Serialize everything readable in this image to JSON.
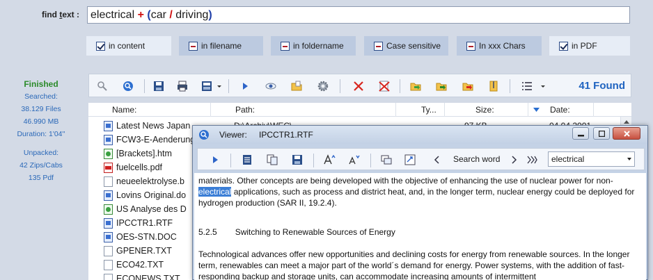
{
  "find": {
    "label_pre": "find ",
    "label_u": "t",
    "label_post": "ext :",
    "q1": "electrical ",
    "plus": "+",
    "open": " (",
    "q2": "car ",
    "slash": "/",
    "q3": " driving",
    "close": ")"
  },
  "filters": [
    {
      "label": "in content",
      "state": "checked"
    },
    {
      "label": "in filename",
      "state": "minus"
    },
    {
      "label": "in foldername",
      "state": "minus"
    },
    {
      "label": "Case sensitive",
      "state": "minus"
    },
    {
      "label": "In xxx Chars",
      "state": "minus"
    },
    {
      "label": "in PDF",
      "state": "checked"
    }
  ],
  "status": {
    "finished": "Finished",
    "searched": "Searched:",
    "files": "38.129 Files",
    "size": "46.990 MB",
    "duration": "Duration: 1'04''",
    "unpacked": "Unpacked:",
    "zips": "42 Zips/Cabs",
    "pdf": "135 Pdf"
  },
  "toolbar": {
    "found": "41 Found"
  },
  "columns": {
    "name": "Name:",
    "path": "Path:",
    "type": "Ty...",
    "size": "Size:",
    "date": "Date:"
  },
  "row0": {
    "path": "D:\\Archiv\\WEC\\",
    "size": "97 KB",
    "date": "04.04.2001"
  },
  "files": [
    {
      "name": "Latest News Japan",
      "icon": "rtf"
    },
    {
      "name": "FCW3-E-Aenderung",
      "icon": "rtf"
    },
    {
      "name": "[Brackets].htm",
      "icon": "htm"
    },
    {
      "name": "fuelcells.pdf",
      "icon": "pdf"
    },
    {
      "name": "neueelektrolyse.b",
      "icon": "txt"
    },
    {
      "name": "Lovins Original.do",
      "icon": "rtf"
    },
    {
      "name": "US Analyse des D",
      "icon": "htm"
    },
    {
      "name": "IPCCTR1.RTF",
      "icon": "rtf"
    },
    {
      "name": "OES-STN.DOC",
      "icon": "rtf"
    },
    {
      "name": "GPENER.TXT",
      "icon": "txt"
    },
    {
      "name": "ECO42.TXT",
      "icon": "txt"
    },
    {
      "name": "ECONEWS.TXT",
      "icon": "txt"
    }
  ],
  "viewer": {
    "title": "Viewer:",
    "filename": "IPCCTR1.RTF",
    "search_word_label": "Search word",
    "search_word_value": "electrical",
    "text": {
      "p1a": "materials. Other concepts are being developed with the objective of enhancing the use of nuclear power for non-",
      "p1hl": "electrical",
      "p1b": " applications, such as process and district heat, and, in the longer term, nuclear energy could be deployed for hydrogen production (SAR II, 19.2.4).",
      "heading_num": "5.2.5",
      "heading": "Switching to Renewable Sources of Energy",
      "p2": "Technological advances offer new opportunities and declining costs for energy from renewable sources. In the longer term, renewables can meet a major part of the world´s demand for energy. Power systems, with the addition of fast-responding backup and storage units, can accommodate increasing amounts of intermittent"
    }
  },
  "colors": {
    "accent": "#1f63c0",
    "finished": "#2a8a28",
    "highlight": "#3b7ed6"
  }
}
